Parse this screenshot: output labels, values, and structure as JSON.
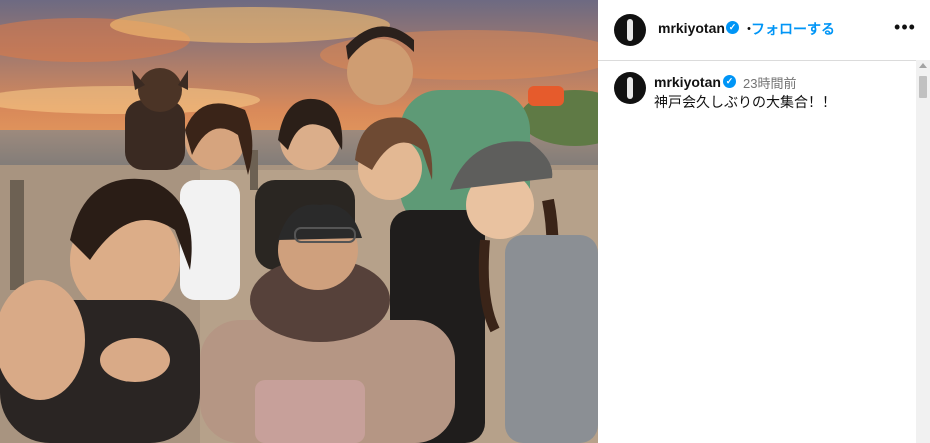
{
  "post": {
    "username": "mrkiyotan",
    "verified_icon": "verified-badge-icon",
    "separator": "・",
    "follow_label": "フォローする",
    "more_icon": "more-options-icon",
    "more_glyph": "•••"
  },
  "comment": {
    "username": "mrkiyotan",
    "time": "23時間前",
    "caption": "神戸会久しぶりの大集合！！"
  },
  "photo": {
    "description_icon": "group-selfie-photo",
    "colors": {
      "sky_top": "#6b6f86",
      "sunset_orange": "#f0a050",
      "sea": "#8a8f95"
    }
  },
  "colors": {
    "accent": "#0095f6",
    "text": "#111111",
    "muted": "#737373",
    "divider": "#dbdbdb"
  }
}
